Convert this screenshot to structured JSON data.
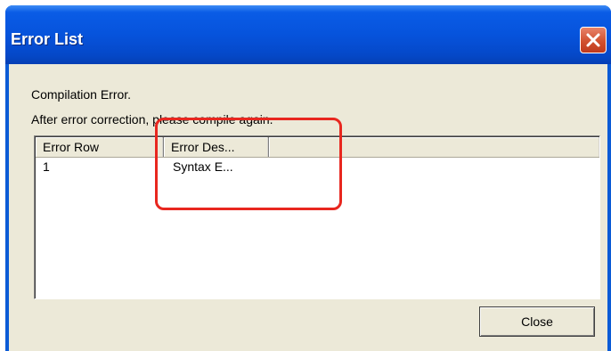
{
  "window": {
    "title": "Error List",
    "close_icon": "close-icon"
  },
  "dialog": {
    "message_line1": "Compilation Error.",
    "message_line2": "After error correction, please compile again."
  },
  "list": {
    "columns": [
      "Error Row",
      "Error Des..."
    ],
    "rows": [
      {
        "error_row": "1",
        "error_description": "Syntax E..."
      }
    ]
  },
  "buttons": {
    "close_label": "Close"
  },
  "colors": {
    "titlebar": "#0653dc",
    "dialog_background": "#ece9d8",
    "annotation": "#e8271f"
  }
}
